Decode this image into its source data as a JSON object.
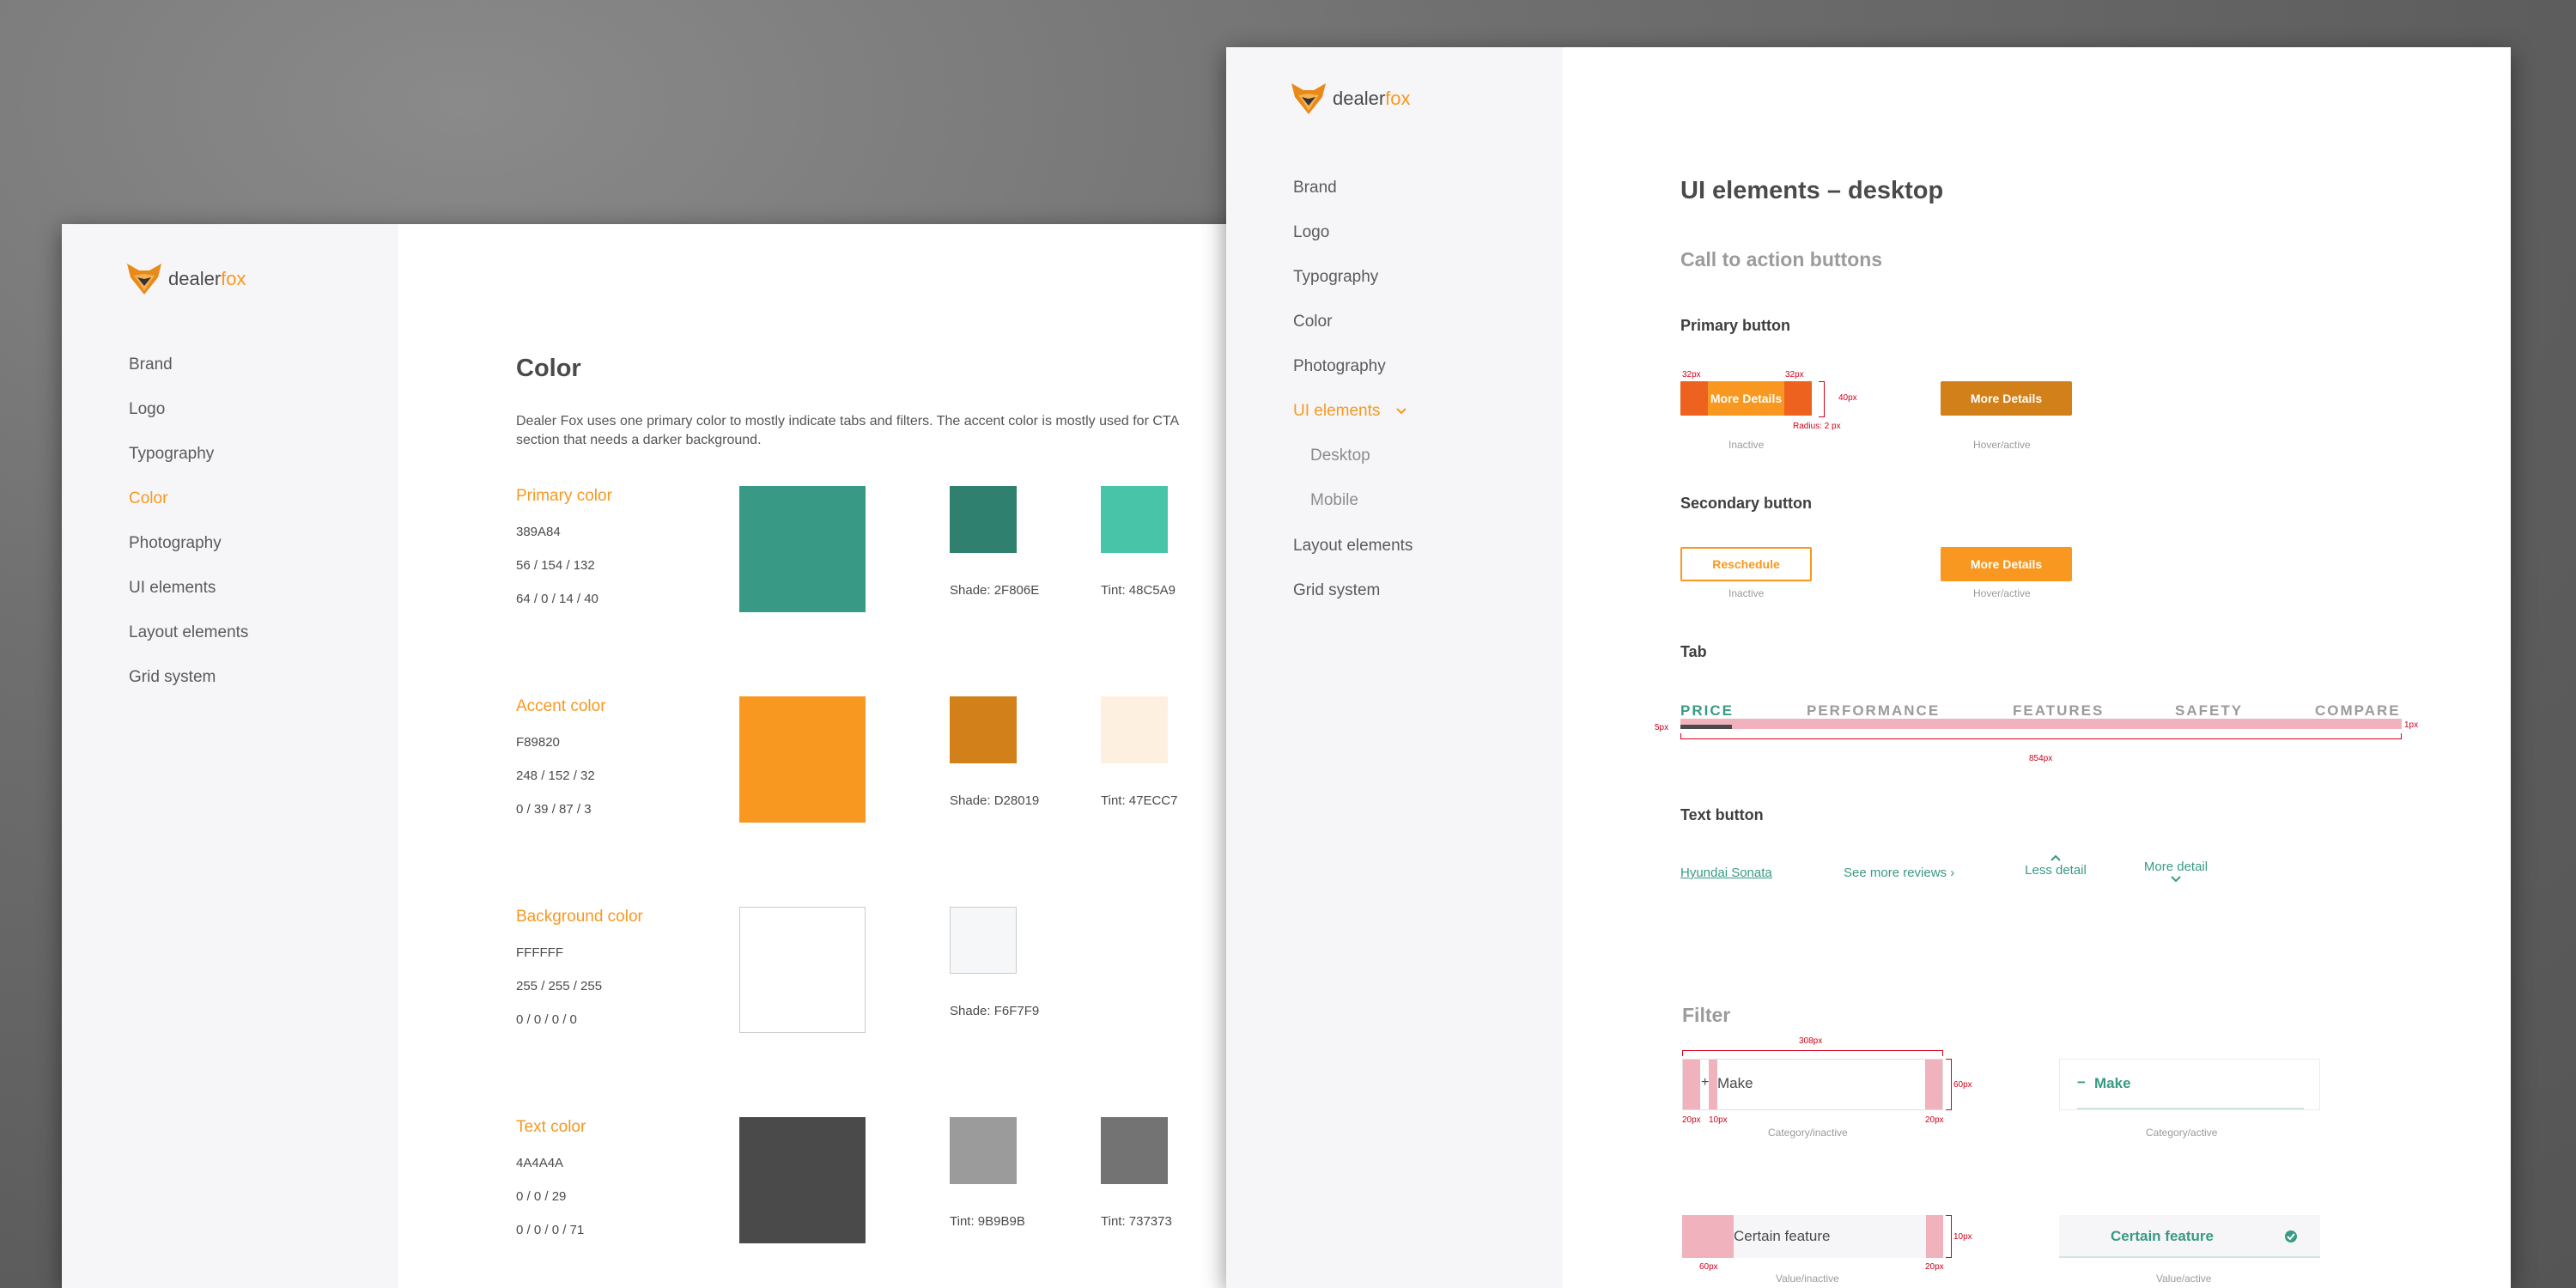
{
  "brand": {
    "dealer": "dealer",
    "fox": "fox"
  },
  "nav": {
    "brand": "Brand",
    "logo": "Logo",
    "typography": "Typography",
    "color": "Color",
    "photography": "Photography",
    "ui_elements": "UI elements",
    "desktop": "Desktop",
    "mobile": "Mobile",
    "layout_elements": "Layout elements",
    "grid_system": "Grid system"
  },
  "color_page": {
    "title": "Color",
    "intro_line1": "Dealer Fox uses one primary color to mostly indicate tabs and filters. The accent color is mostly used for CTA",
    "intro_line2": "section that needs a darker background.",
    "groups": [
      {
        "label": "Primary color",
        "hex": "389A84",
        "rgb": "56 / 154 / 132",
        "cmyk": "64 / 0 / 14 / 40",
        "main": "#389a84",
        "s1": "#2f806e",
        "s1_label": "Shade: 2F806E",
        "s2": "#48c5a9",
        "s2_label": "Tint: 48C5A9"
      },
      {
        "label": "Accent color",
        "hex": "F89820",
        "rgb": "248 / 152 / 32",
        "cmyk": "0 / 39 / 87 / 3",
        "main": "#f89820",
        "s1": "#d28019",
        "s1_label": "Shade: D28019",
        "s2": "#fef0e0",
        "s2_label": "Tint: 47ECC7"
      },
      {
        "label": "Background color",
        "hex": "FFFFFF",
        "rgb": "255 / 255 / 255",
        "cmyk": "0 / 0 / 0 / 0",
        "main": "#ffffff",
        "s1": "#f6f7f9",
        "s1_label": "Shade: F6F7F9"
      },
      {
        "label": "Text color",
        "hex": "4A4A4A",
        "rgb": "0 / 0 / 29",
        "cmyk": "0 / 0 / 0 / 71",
        "main": "#4a4a4a",
        "s1": "#9b9b9b",
        "s1_label": "Tint: 9B9B9B",
        "s2": "#737373",
        "s2_label": "Tint: 737373"
      }
    ]
  },
  "ui_page": {
    "title": "UI elements – desktop",
    "cta_title": "Call to action buttons",
    "primary_title": "Primary button",
    "more_details": "More Details",
    "inactive": "Inactive",
    "hover_active": "Hover/active",
    "spec_32px": "32px",
    "spec_40px": "40px",
    "spec_radius": "Radius: 2 px",
    "secondary_title": "Secondary button",
    "reschedule": "Reschedule",
    "tab_title": "Tab",
    "tabs": [
      "PRICE",
      "PERFORMANCE",
      "FEATURES",
      "SAFETY",
      "COMPARE"
    ],
    "spec_5px": "5px",
    "spec_1px": "1px",
    "spec_854px": "854px",
    "text_button_title": "Text button",
    "link_sonata": "Hyundai Sonata",
    "see_more_reviews": "See more reviews",
    "less_detail": "Less detail",
    "more_detail": "More detail",
    "filter_title": "Filter",
    "spec_308px": "308px",
    "spec_60px": "60px",
    "spec_20px": "20px",
    "spec_10px": "10px",
    "make": "Make",
    "category_inactive": "Category/inactive",
    "category_active": "Category/active",
    "certain_feature": "Certain feature",
    "value_inactive": "Value/inactive",
    "value_active": "Value/active"
  },
  "colors": {
    "primary": "#389a84",
    "accent": "#f89820",
    "text": "#4a4a4a",
    "spec_red": "#d0021b"
  }
}
